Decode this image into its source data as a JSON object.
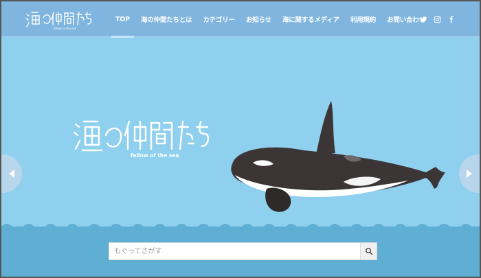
{
  "site": {
    "logo_text": "海の仲間たち",
    "logo_subtitle": "fellow of the sea"
  },
  "nav": {
    "items": [
      {
        "label": "TOP",
        "active": true
      },
      {
        "label": "海の仲間たちとは",
        "active": false
      },
      {
        "label": "カテゴリー",
        "active": false
      },
      {
        "label": "お知らせ",
        "active": false
      },
      {
        "label": "海に関するメディア",
        "active": false
      },
      {
        "label": "利用規約",
        "active": false
      },
      {
        "label": "お問い合わせ",
        "active": false
      }
    ]
  },
  "social": [
    "twitter-icon",
    "instagram-icon",
    "facebook-icon"
  ],
  "hero": {
    "title": "海の仲間たち",
    "subtitle": "fellow of the sea"
  },
  "search": {
    "placeholder": "もぐってさがす",
    "value": ""
  },
  "colors": {
    "header": "#7fb5de",
    "sky": "#8fd0ee",
    "sea": "#5faed3",
    "orca_body": "#3b3535"
  }
}
